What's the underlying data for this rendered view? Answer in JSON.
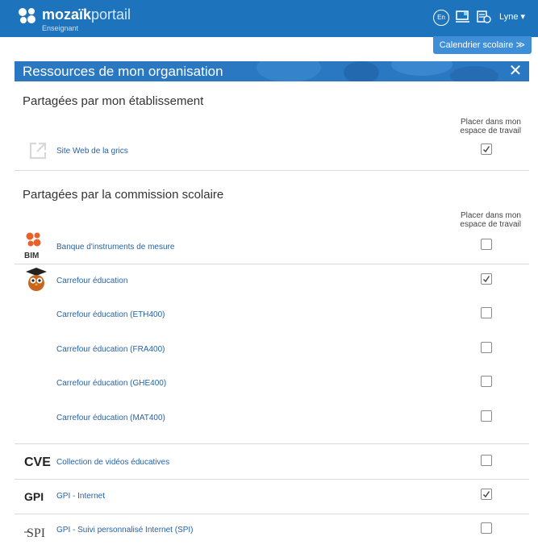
{
  "app": {
    "brand_bold": "mozaïk",
    "brand_light": "portail",
    "role": "Enseignant",
    "lang_button": "En",
    "user": "Lyne ▾",
    "calendar_button": "Calendrier scolaire ≫"
  },
  "panel": {
    "title": "Ressources de mon organisation",
    "close": "✕"
  },
  "sections": {
    "school": {
      "title": "Partagées par mon établissement",
      "column_header": "Placer dans mon espace de travail",
      "items": [
        {
          "label": "Site Web de la grics",
          "icon": "external-link-icon",
          "checked": true
        }
      ]
    },
    "board": {
      "title": "Partagées par la commission scolaire",
      "column_header": "Placer dans mon espace de travail",
      "items": [
        {
          "label": "Banque d'instruments de mesure",
          "icon": "bim-logo",
          "icon_text": "BIM",
          "checked": false
        },
        {
          "label": "Carrefour éducation",
          "icon": "owl-graduate-icon",
          "checked": true
        },
        {
          "label": "Carrefour éducation (ETH400)",
          "checked": false
        },
        {
          "label": "Carrefour éducation (FRA400)",
          "checked": false
        },
        {
          "label": "Carrefour éducation (GHE400)",
          "checked": false
        },
        {
          "label": "Carrefour éducation (MAT400)",
          "checked": false
        },
        {
          "label": "Collection de vidéos éducatives",
          "icon": "cve-logo",
          "icon_text": "CVE",
          "checked": false
        },
        {
          "label": "GPI - Internet",
          "icon": "gpi-logo",
          "icon_text": "GPI",
          "checked": true
        },
        {
          "label": "GPI - Suivi personnalisé Internet (SPI)",
          "icon": "spi-logo",
          "icon_text": "SPI",
          "checked": false
        }
      ]
    }
  },
  "colors": {
    "topbar": "#1e73bd",
    "panel_header": "#2a78c2",
    "link": "#2563a6",
    "bim_orange": "#e8622a"
  }
}
